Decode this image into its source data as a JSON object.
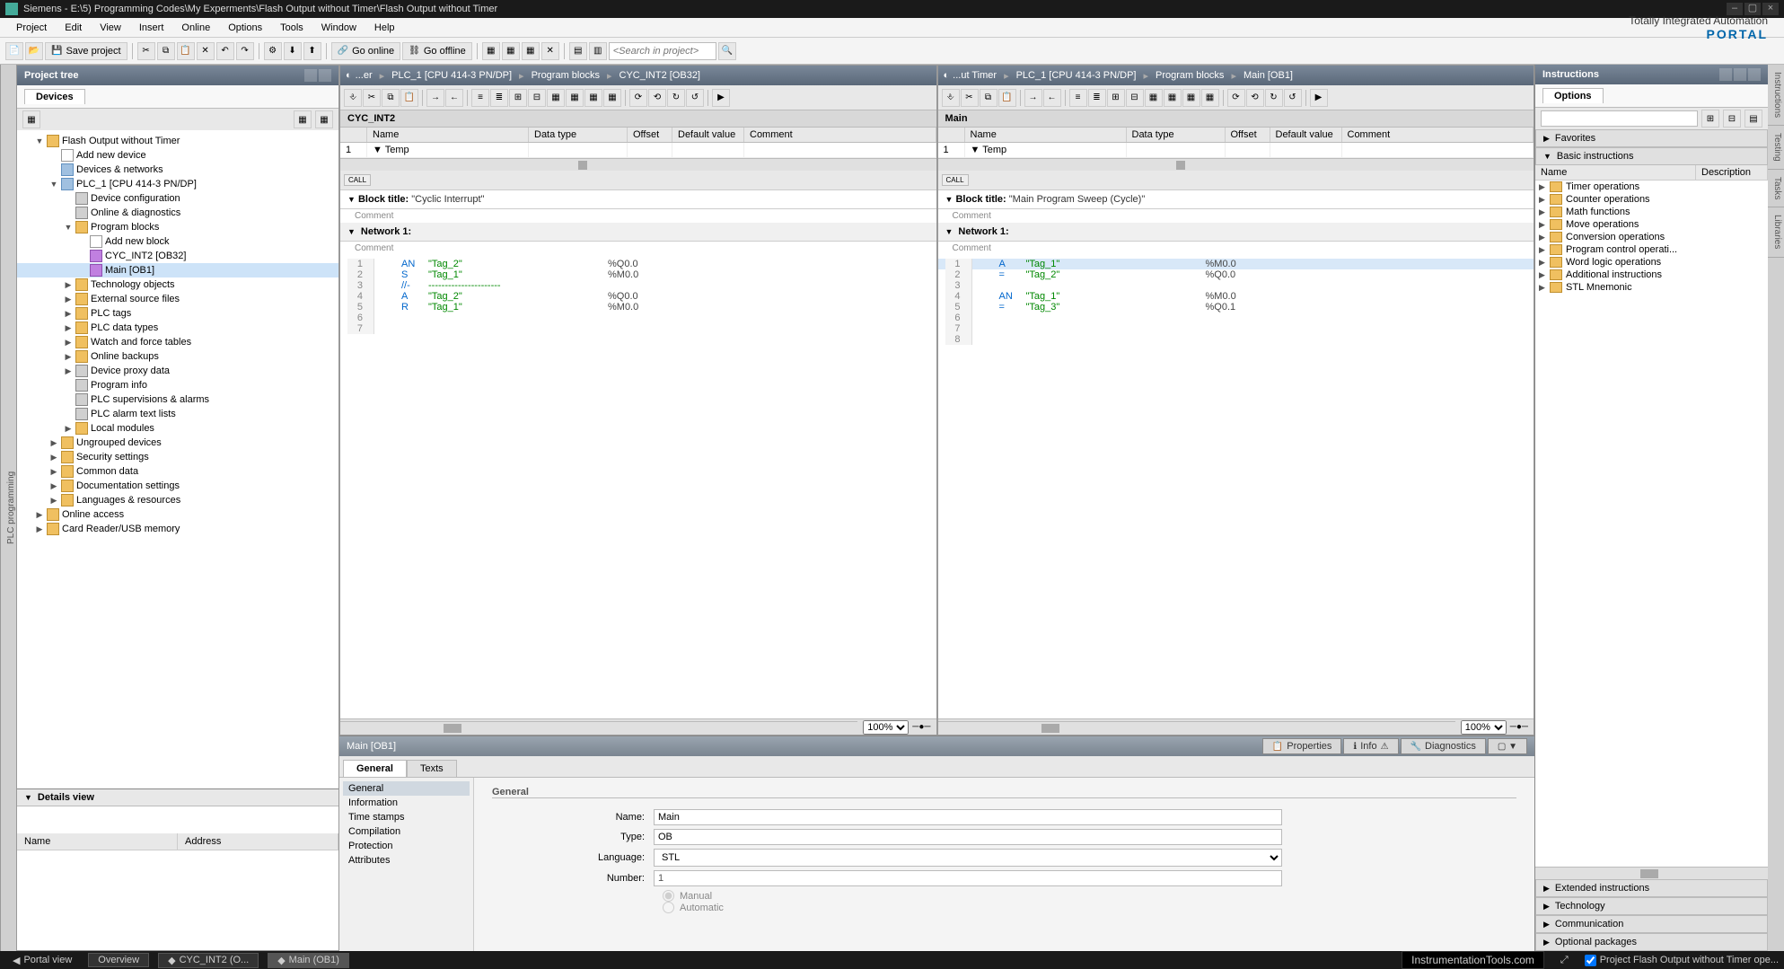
{
  "title": "Siemens - E:\\5) Programming Codes\\My Experments\\Flash Output without Timer\\Flash Output without Timer",
  "menu": [
    "Project",
    "Edit",
    "View",
    "Insert",
    "Online",
    "Options",
    "Tools",
    "Window",
    "Help"
  ],
  "branding": {
    "line1": "Totally Integrated Automation",
    "line2": "PORTAL"
  },
  "toolbar": {
    "save": "Save project",
    "go_online": "Go online",
    "go_offline": "Go offline",
    "search_ph": "<Search in project>"
  },
  "project_tree": {
    "title": "Project tree",
    "tab": "Devices",
    "root": "Flash Output without Timer",
    "items": [
      {
        "ind": 1,
        "exp": "▼",
        "icon": "folder",
        "label": "Flash Output without Timer"
      },
      {
        "ind": 2,
        "exp": "",
        "icon": "add",
        "label": "Add new device"
      },
      {
        "ind": 2,
        "exp": "",
        "icon": "device",
        "label": "Devices & networks"
      },
      {
        "ind": 2,
        "exp": "▼",
        "icon": "device",
        "label": "PLC_1 [CPU 414-3 PN/DP]"
      },
      {
        "ind": 3,
        "exp": "",
        "icon": "generic",
        "label": "Device configuration"
      },
      {
        "ind": 3,
        "exp": "",
        "icon": "generic",
        "label": "Online & diagnostics"
      },
      {
        "ind": 3,
        "exp": "▼",
        "icon": "folder",
        "label": "Program blocks"
      },
      {
        "ind": 4,
        "exp": "",
        "icon": "add",
        "label": "Add new block"
      },
      {
        "ind": 4,
        "exp": "",
        "icon": "block",
        "label": "CYC_INT2 [OB32]"
      },
      {
        "ind": 4,
        "exp": "",
        "icon": "block",
        "label": "Main [OB1]",
        "sel": true
      },
      {
        "ind": 3,
        "exp": "▶",
        "icon": "folder",
        "label": "Technology objects"
      },
      {
        "ind": 3,
        "exp": "▶",
        "icon": "folder",
        "label": "External source files"
      },
      {
        "ind": 3,
        "exp": "▶",
        "icon": "folder",
        "label": "PLC tags"
      },
      {
        "ind": 3,
        "exp": "▶",
        "icon": "folder",
        "label": "PLC data types"
      },
      {
        "ind": 3,
        "exp": "▶",
        "icon": "folder",
        "label": "Watch and force tables"
      },
      {
        "ind": 3,
        "exp": "▶",
        "icon": "folder",
        "label": "Online backups"
      },
      {
        "ind": 3,
        "exp": "▶",
        "icon": "generic",
        "label": "Device proxy data"
      },
      {
        "ind": 3,
        "exp": "",
        "icon": "generic",
        "label": "Program info"
      },
      {
        "ind": 3,
        "exp": "",
        "icon": "generic",
        "label": "PLC supervisions & alarms"
      },
      {
        "ind": 3,
        "exp": "",
        "icon": "generic",
        "label": "PLC alarm text lists"
      },
      {
        "ind": 3,
        "exp": "▶",
        "icon": "folder",
        "label": "Local modules"
      },
      {
        "ind": 2,
        "exp": "▶",
        "icon": "folder",
        "label": "Ungrouped devices"
      },
      {
        "ind": 2,
        "exp": "▶",
        "icon": "folder",
        "label": "Security settings"
      },
      {
        "ind": 2,
        "exp": "▶",
        "icon": "folder",
        "label": "Common data"
      },
      {
        "ind": 2,
        "exp": "▶",
        "icon": "folder",
        "label": "Documentation settings"
      },
      {
        "ind": 2,
        "exp": "▶",
        "icon": "folder",
        "label": "Languages & resources"
      },
      {
        "ind": 1,
        "exp": "▶",
        "icon": "folder",
        "label": "Online access"
      },
      {
        "ind": 1,
        "exp": "▶",
        "icon": "folder",
        "label": "Card Reader/USB memory"
      }
    ]
  },
  "details": {
    "title": "Details view",
    "cols": [
      "Name",
      "Address"
    ]
  },
  "editor1": {
    "crumbs": [
      "...er",
      "PLC_1 [CPU 414-3 PN/DP]",
      "Program blocks",
      "CYC_INT2 [OB32]"
    ],
    "name": "CYC_INT2",
    "grid_cols": [
      "Name",
      "Data type",
      "Offset",
      "Default value",
      "Comment"
    ],
    "grid_row1": "Temp",
    "call": "CALL",
    "block_title_label": "Block title:",
    "block_title_val": "\"Cyclic Interrupt\"",
    "comment": "Comment",
    "network": "Network 1:",
    "stl": [
      {
        "ln": "1",
        "op": "AN",
        "arg": "\"Tag_2\"",
        "addr": "%Q0.0"
      },
      {
        "ln": "2",
        "op": "S",
        "arg": "\"Tag_1\"",
        "addr": "%M0.0"
      },
      {
        "ln": "3",
        "op": "//-",
        "arg": "----------------------",
        "addr": ""
      },
      {
        "ln": "4",
        "op": "A",
        "arg": "\"Tag_2\"",
        "addr": "%Q0.0"
      },
      {
        "ln": "5",
        "op": "R",
        "arg": "\"Tag_1\"",
        "addr": "%M0.0"
      },
      {
        "ln": "6",
        "op": "",
        "arg": "",
        "addr": ""
      },
      {
        "ln": "7",
        "op": "",
        "arg": "",
        "addr": ""
      }
    ],
    "zoom": "100%"
  },
  "editor2": {
    "crumbs": [
      "...ut Timer",
      "PLC_1 [CPU 414-3 PN/DP]",
      "Program blocks",
      "Main [OB1]"
    ],
    "name": "Main",
    "grid_cols": [
      "Name",
      "Data type",
      "Offset",
      "Default value",
      "Comment"
    ],
    "grid_row1": "Temp",
    "call": "CALL",
    "block_title_label": "Block title:",
    "block_title_val": "\"Main Program Sweep (Cycle)\"",
    "comment": "Comment",
    "network": "Network 1:",
    "stl": [
      {
        "ln": "1",
        "op": "A",
        "arg": "\"Tag_1\"",
        "addr": "%M0.0",
        "sel": true
      },
      {
        "ln": "2",
        "op": "=",
        "arg": "\"Tag_2\"",
        "addr": "%Q0.0"
      },
      {
        "ln": "3",
        "op": "",
        "arg": "",
        "addr": ""
      },
      {
        "ln": "4",
        "op": "AN",
        "arg": "\"Tag_1\"",
        "addr": "%M0.0"
      },
      {
        "ln": "5",
        "op": "=",
        "arg": "\"Tag_3\"",
        "addr": "%Q0.1"
      },
      {
        "ln": "6",
        "op": "",
        "arg": "",
        "addr": ""
      },
      {
        "ln": "7",
        "op": "",
        "arg": "",
        "addr": ""
      },
      {
        "ln": "8",
        "op": "",
        "arg": "",
        "addr": ""
      }
    ],
    "zoom": "100%"
  },
  "props": {
    "title": "Main [OB1]",
    "tabs_right": [
      "Properties",
      "Info",
      "Diagnostics"
    ],
    "tabs": [
      "General",
      "Texts"
    ],
    "nav": [
      "General",
      "Information",
      "Time stamps",
      "Compilation",
      "Protection",
      "Attributes"
    ],
    "section": "General",
    "fields": {
      "name_l": "Name:",
      "name_v": "Main",
      "type_l": "Type:",
      "type_v": "OB",
      "lang_l": "Language:",
      "lang_v": "STL",
      "num_l": "Number:",
      "num_v": "1",
      "manual": "Manual",
      "auto": "Automatic"
    }
  },
  "instructions": {
    "title": "Instructions",
    "options": "Options",
    "accordions": [
      "Favorites",
      "Basic instructions",
      "Extended instructions",
      "Technology",
      "Communication",
      "Optional packages"
    ],
    "cols": [
      "Name",
      "Description"
    ],
    "items": [
      "Timer operations",
      "Counter operations",
      "Math functions",
      "Move operations",
      "Conversion operations",
      "Program control operati...",
      "Word logic operations",
      "Additional instructions",
      "STL Mnemonic"
    ]
  },
  "side_tabs": [
    "Instructions",
    "Testing",
    "Tasks",
    "Libraries"
  ],
  "left_tab": "PLC programming",
  "status": {
    "portal": "Portal view",
    "overview": "Overview",
    "tab1": "CYC_INT2 (O...",
    "tab2": "Main (OB1)",
    "watermark": "InstrumentationTools.com",
    "check": "Project Flash Output without Timer ope..."
  }
}
